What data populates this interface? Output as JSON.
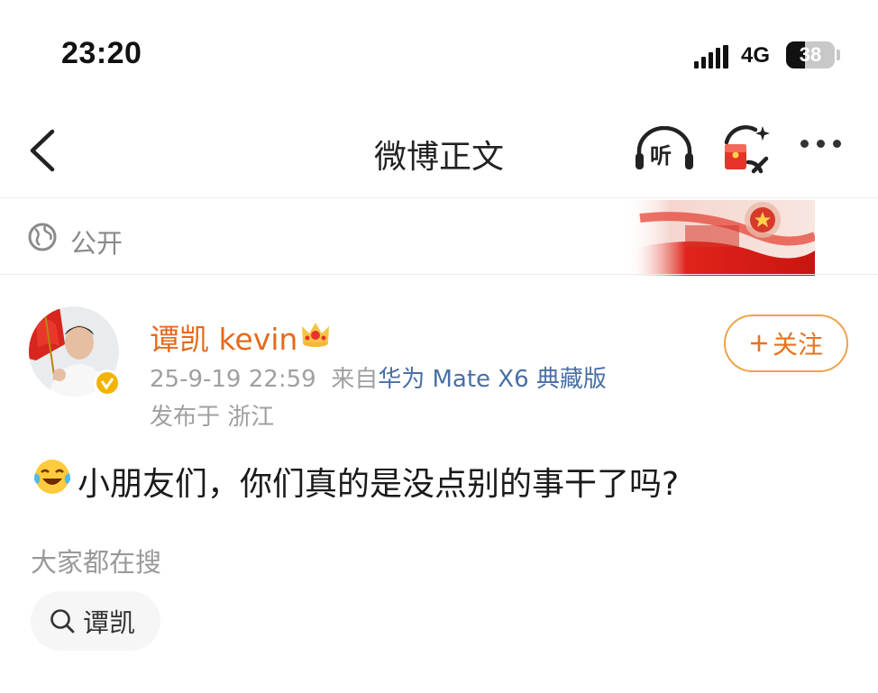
{
  "status_bar": {
    "time": "23:20",
    "network": "4G",
    "battery": "38",
    "battery_level": 0.38,
    "signal_icon": "signal-bars-icon"
  },
  "nav": {
    "title": "微博正文",
    "back_icon": "chevron-left-icon",
    "listen_label": "听",
    "listen_icon": "headphones-icon",
    "red_packet_icon": "red-packet-sparkle-icon",
    "more_icon": "more-dots-icon"
  },
  "visibility": {
    "icon": "globe-icon",
    "label": "公开"
  },
  "post": {
    "author": "谭凯 kevin",
    "author_color": "#e46b1c",
    "crown_icon": "crown-icon",
    "verified_icon": "verified-badge-icon",
    "follow_label": "关注",
    "follow_color": "#e8731d",
    "date": "25-9-19 22:59",
    "source_prefix": "来自",
    "source_device": "华为 Mate X6 典藏版",
    "location": "发布于 浙江",
    "emoji_icon": "crying-laughing-emoji-icon",
    "text": "小朋友们，你们真的是没点别的事干了吗?"
  },
  "search": {
    "heading": "大家都在搜",
    "chip_icon": "search-icon",
    "chip_label": "谭凯"
  }
}
